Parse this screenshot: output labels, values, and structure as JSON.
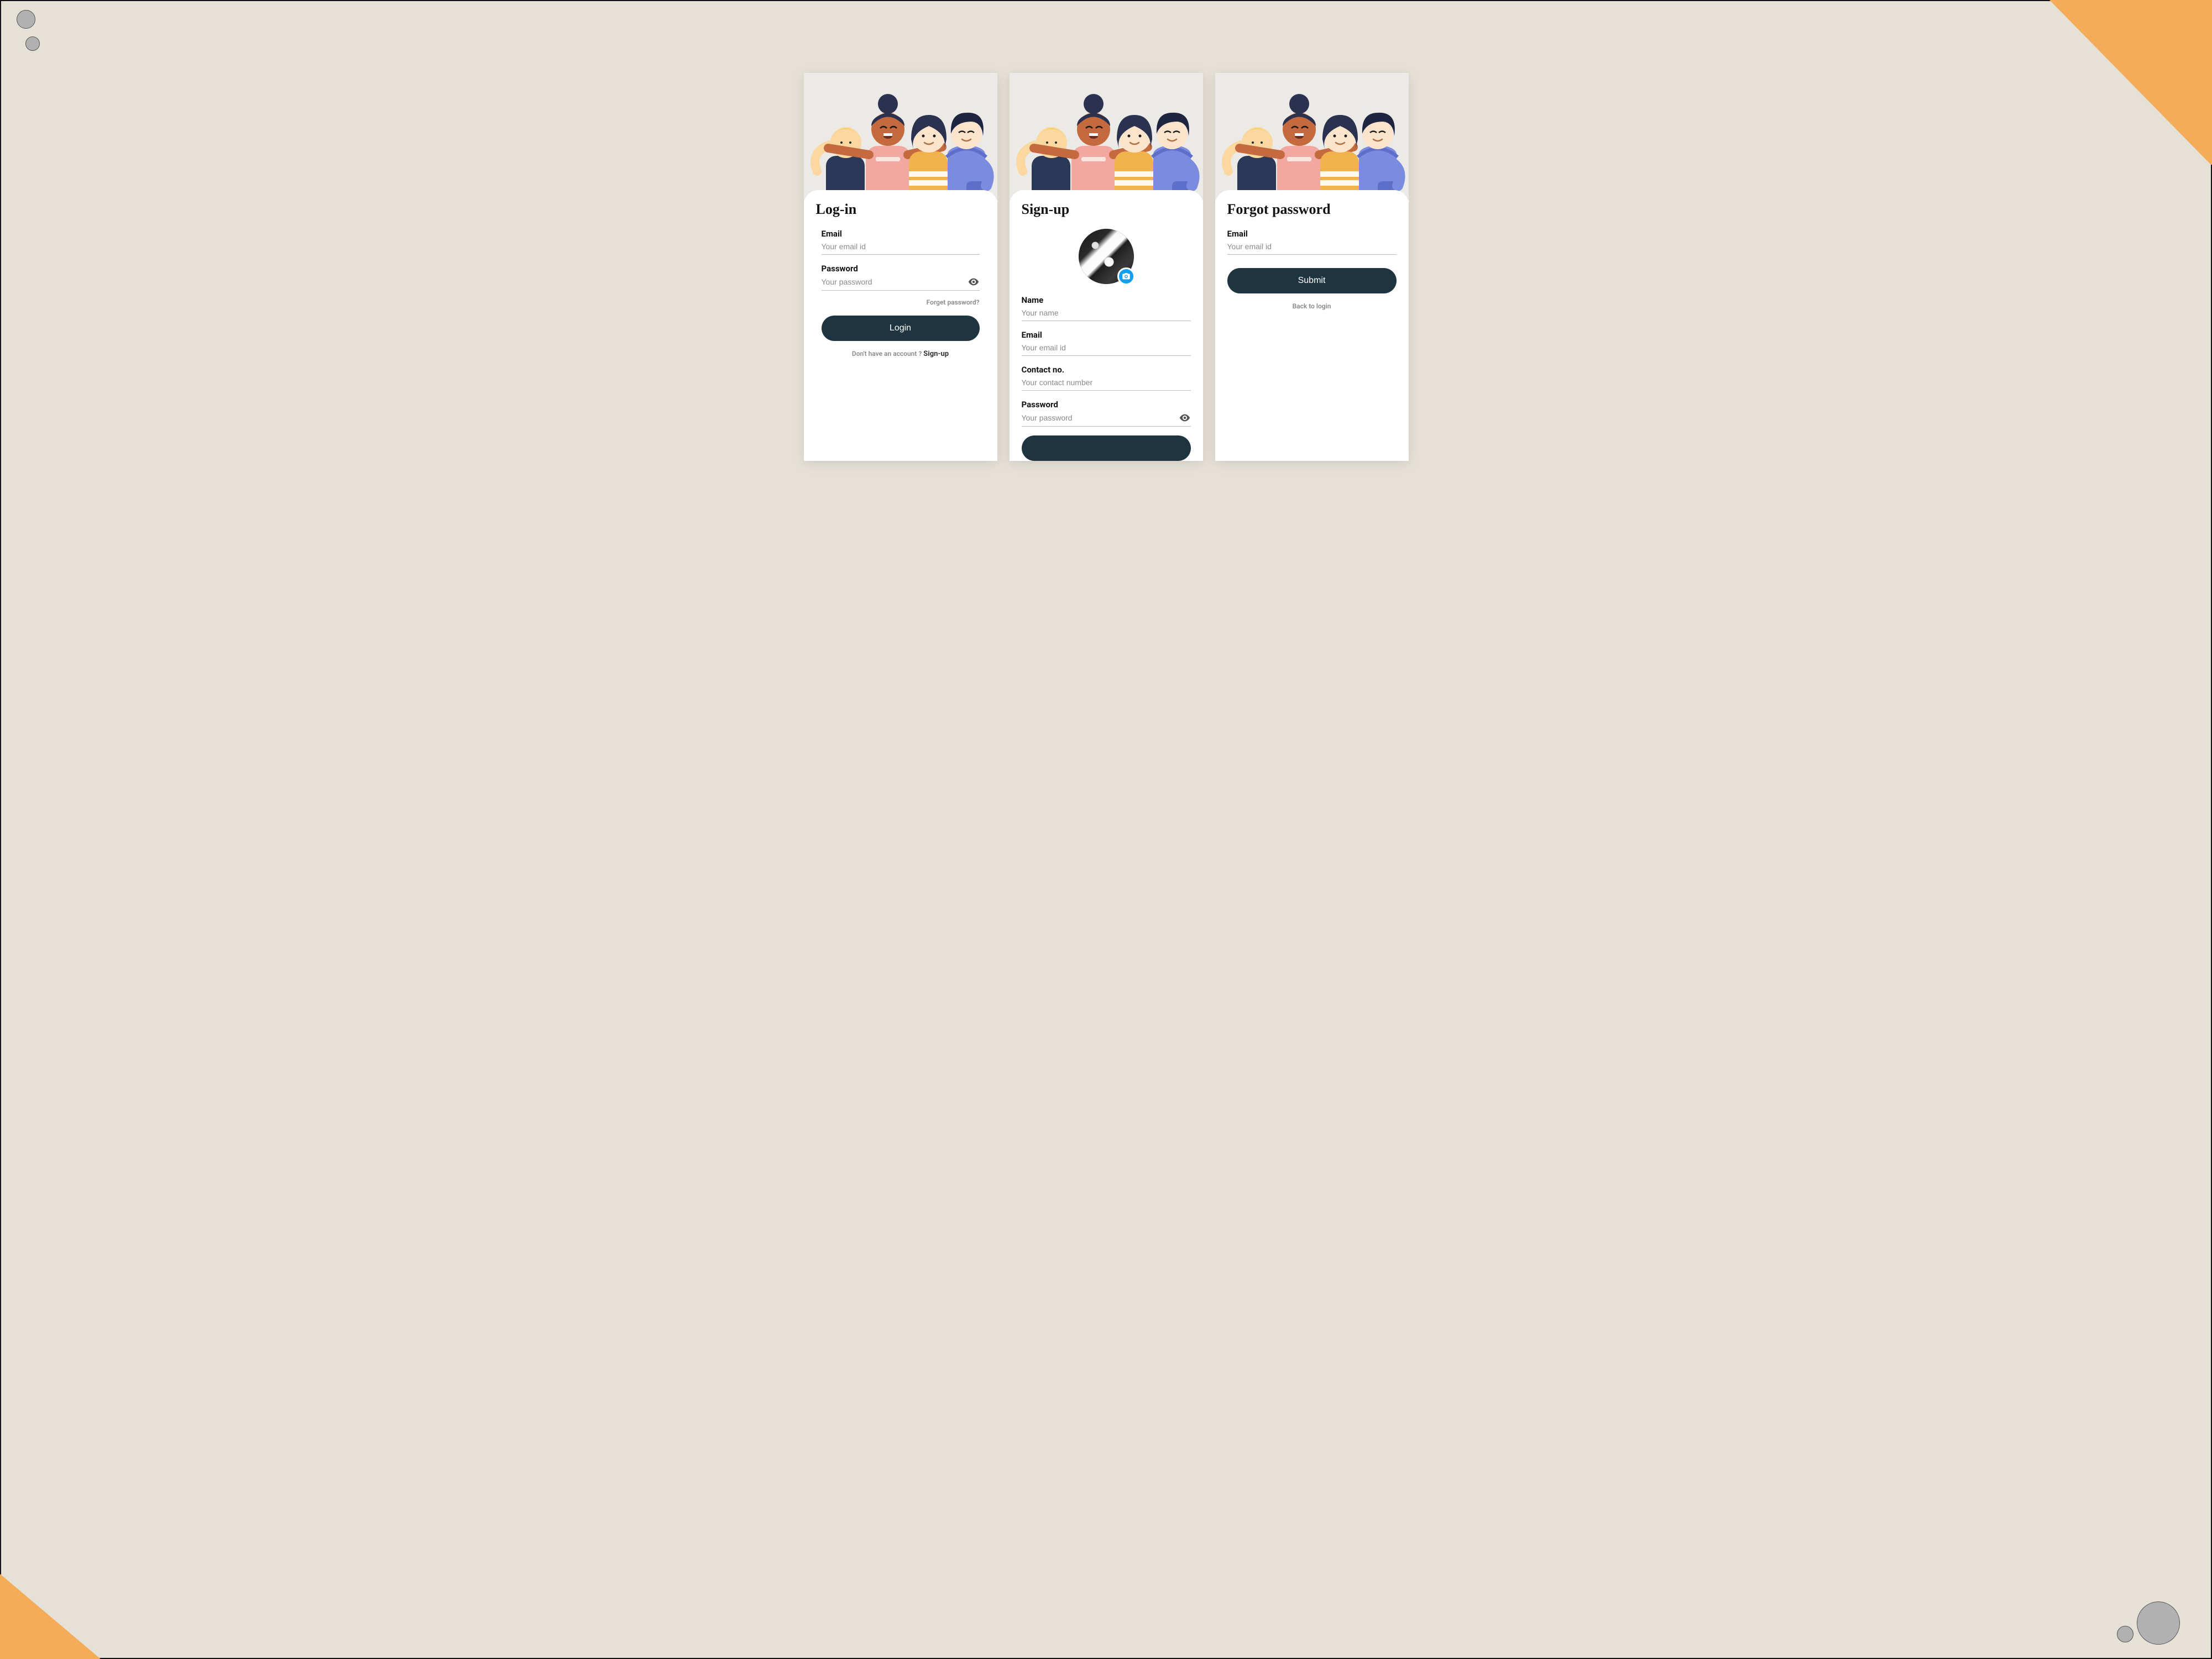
{
  "login": {
    "title": "Log-in",
    "email_label": "Email",
    "email_placeholder": "Your email id",
    "password_label": "Password",
    "password_placeholder": "Your password",
    "forgot_link": "Forget password?",
    "button": "Login",
    "no_account_text": "Don't have an account ? ",
    "signup_link": "Sign-up"
  },
  "signup": {
    "title": "Sign-up",
    "name_label": "Name",
    "name_placeholder": "Your name",
    "email_label": "Email",
    "email_placeholder": "Your email id",
    "contact_label": "Contact no.",
    "contact_placeholder": "Your contact number",
    "password_label": "Password",
    "password_placeholder": "Your password"
  },
  "forgot": {
    "title": "Forgot password",
    "email_label": "Email",
    "email_placeholder": "Your email id",
    "button": "Submit",
    "back_link": "Back to login"
  },
  "icons": {
    "eye": "eye-icon",
    "camera": "camera-icon"
  },
  "colors": {
    "bg": "#e5e1d7",
    "accent_orange": "#f4ac59",
    "primary_dark": "#1e3541",
    "badge_blue": "#139ef0"
  }
}
